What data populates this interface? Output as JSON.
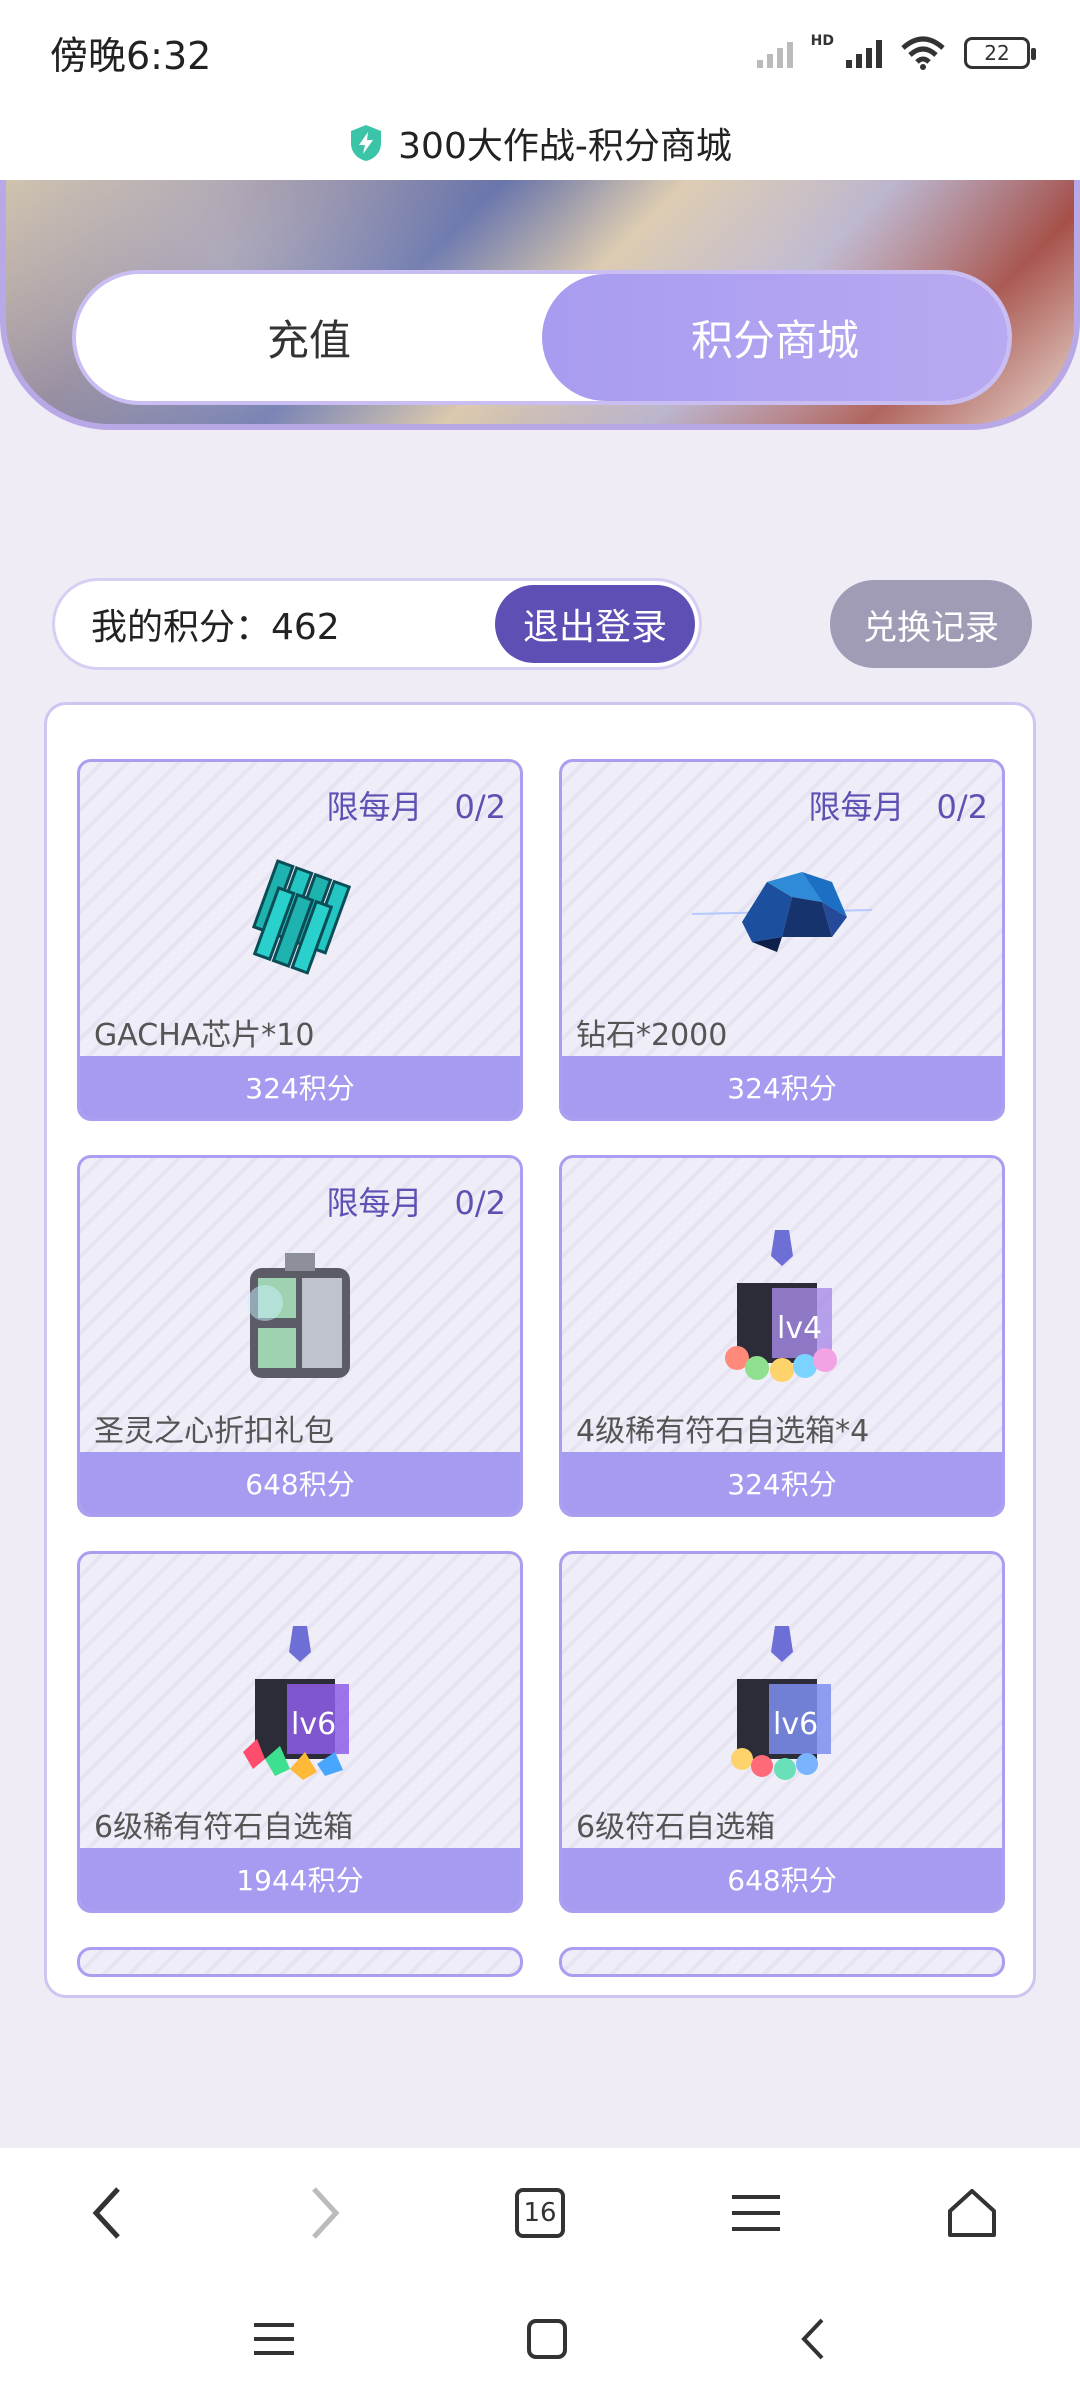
{
  "status_bar": {
    "time": "傍晚6:32",
    "battery": "22",
    "network": "HD"
  },
  "titlebar": {
    "title": "300大作战-积分商城",
    "icon": "shield-bolt-icon"
  },
  "tabs": [
    {
      "label": "充值",
      "active": false
    },
    {
      "label": "积分商城",
      "active": true
    }
  ],
  "points": {
    "label": "我的积分：462",
    "logout_label": "退出登录",
    "history_label": "兑换记录"
  },
  "items": [
    {
      "limit": "限每月　0/2",
      "name": "GACHA芯片*10",
      "price": "324积分",
      "icon": "chip-stack-icon"
    },
    {
      "limit": "限每月　0/2",
      "name": "钻石*2000",
      "price": "324积分",
      "icon": "diamond-cluster-icon"
    },
    {
      "limit": "限每月　0/2",
      "name": "圣灵之心折扣礼包",
      "price": "648积分",
      "icon": "gift-canister-icon"
    },
    {
      "limit": "",
      "name": "4级稀有符石自选箱*4",
      "price": "324积分",
      "icon": "rune-box-icon"
    },
    {
      "limit": "",
      "name": "6级稀有符石自选箱",
      "price": "1944积分",
      "icon": "rune-box-icon"
    },
    {
      "limit": "",
      "name": "6级符石自选箱",
      "price": "648积分",
      "icon": "rune-box-icon"
    }
  ],
  "browser_nav": {
    "tabs_count": "16"
  },
  "colors": {
    "accent": "#a59bf1",
    "dark_accent": "#5d4fb3",
    "limit_text": "#5d52b4"
  }
}
